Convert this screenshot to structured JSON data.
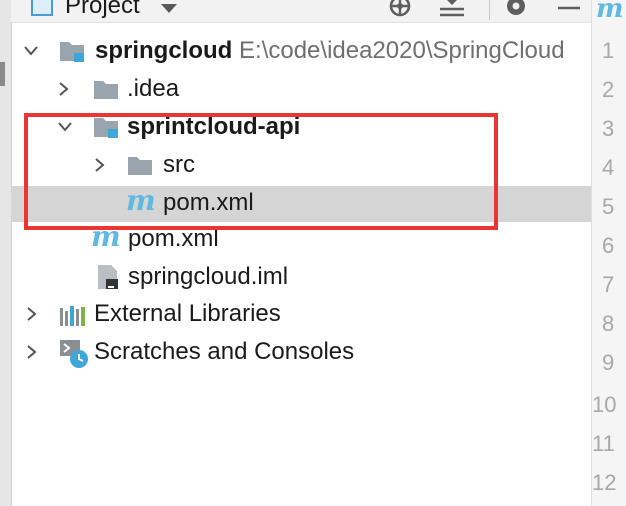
{
  "panel": {
    "title": "Project"
  },
  "tree": {
    "root": {
      "name": "springcloud",
      "path": "E:\\code\\idea2020\\SpringCloud"
    },
    "idea_folder": ".idea",
    "module": {
      "name": "sprintcloud-api"
    },
    "src_folder": "src",
    "module_pom": "pom.xml",
    "root_pom": "pom.xml",
    "iml_file": "springcloud.iml",
    "external_libraries": "External Libraries",
    "scratches": "Scratches and Consoles"
  },
  "editor": {
    "tab_icon": "m",
    "line_numbers": [
      "1",
      "2",
      "3",
      "4",
      "5",
      "6",
      "7",
      "8",
      "9",
      "10",
      "11",
      "12"
    ]
  },
  "colors": {
    "highlight": "#ea3535",
    "selection": "#d5d5d5",
    "maven_icon": "#60b9e0",
    "folder": "#9aa4ae",
    "module_badge": "#3fa6d9"
  }
}
